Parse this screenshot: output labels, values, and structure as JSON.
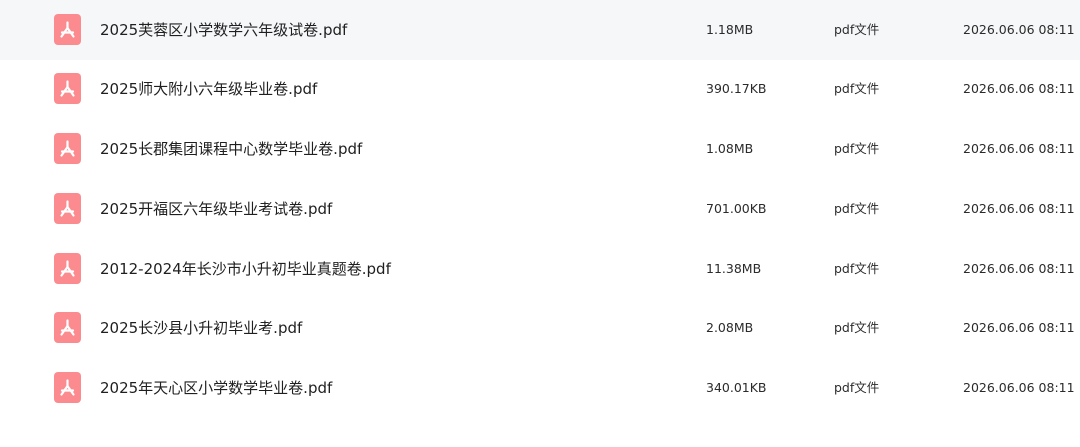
{
  "files": [
    {
      "name": "2025芙蓉区小学数学六年级试卷.pdf",
      "size": "1.18MB",
      "type": "pdf文件",
      "date": "2026.06.06 08:11",
      "icon": "pdf-file-icon"
    },
    {
      "name": "2025师大附小六年级毕业卷.pdf",
      "size": "390.17KB",
      "type": "pdf文件",
      "date": "2026.06.06 08:11",
      "icon": "pdf-file-icon"
    },
    {
      "name": "2025长郡集团课程中心数学毕业卷.pdf",
      "size": "1.08MB",
      "type": "pdf文件",
      "date": "2026.06.06 08:11",
      "icon": "pdf-file-icon"
    },
    {
      "name": "2025开福区六年级毕业考试卷.pdf",
      "size": "701.00KB",
      "type": "pdf文件",
      "date": "2026.06.06 08:11",
      "icon": "pdf-file-icon"
    },
    {
      "name": "2012-2024年长沙市小升初毕业真题卷.pdf",
      "size": "11.38MB",
      "type": "pdf文件",
      "date": "2026.06.06 08:11",
      "icon": "pdf-file-icon"
    },
    {
      "name": "2025长沙县小升初毕业考.pdf",
      "size": "2.08MB",
      "type": "pdf文件",
      "date": "2026.06.06 08:11",
      "icon": "pdf-file-icon"
    },
    {
      "name": "2025年天心区小学数学毕业卷.pdf",
      "size": "340.01KB",
      "type": "pdf文件",
      "date": "2026.06.06 08:11",
      "icon": "pdf-file-icon"
    }
  ],
  "colors": {
    "pdf_icon_bg": "#fc8b8f",
    "pdf_icon_glyph": "#ffffff"
  }
}
